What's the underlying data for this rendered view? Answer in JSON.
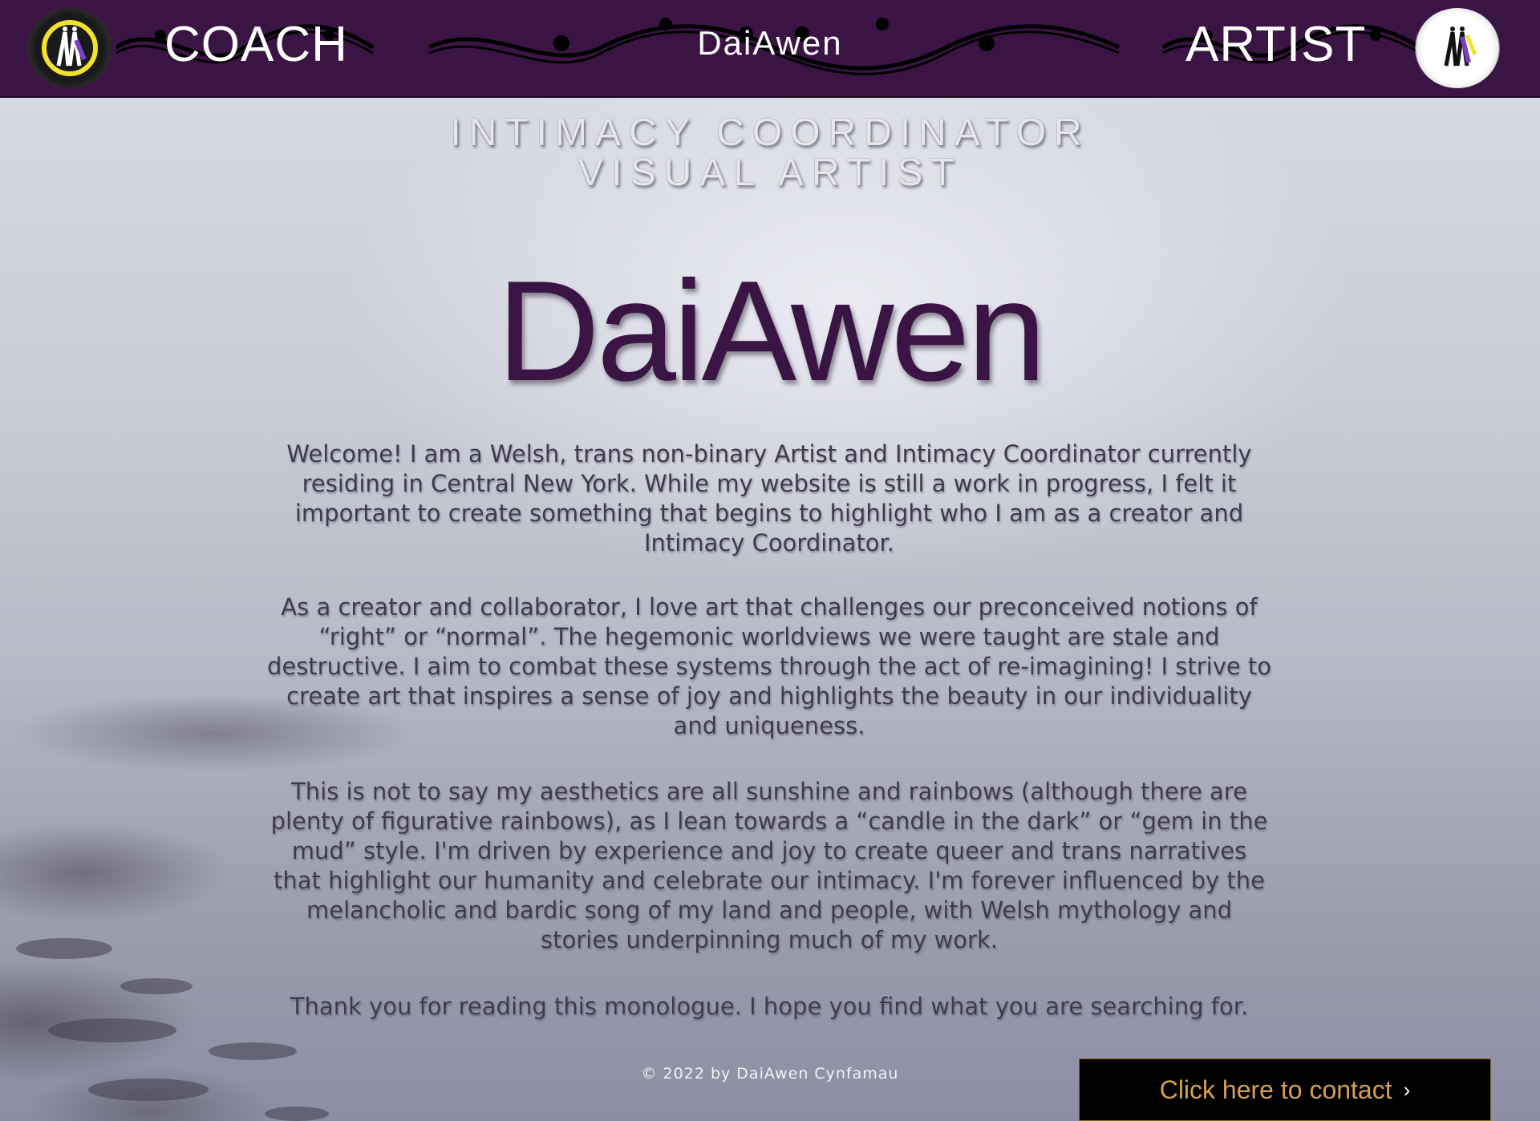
{
  "header": {
    "left_link": "COACH",
    "brand": "DaiAwen",
    "right_link": "ARTIST"
  },
  "main": {
    "subtitle_lines": [
      "INTIMACY COORDINATOR",
      "VISUAL ARTIST"
    ],
    "hero_title": "DaiAwen",
    "paragraphs": [
      "Welcome!  I am a Welsh, trans non-binary Artist and Intimacy Coordinator currently residing in Central New York. While my website is still a work in progress, I felt it important to create something that begins to highlight who I am as a creator and Intimacy Coordinator.",
      "As a creator and collaborator, I love art that challenges our preconceived notions of “right” or “normal”. The hegemonic worldviews we were taught are stale and destructive. I aim to combat these systems through the act of re-imagining! I strive to create art that inspires a sense of joy and highlights the beauty in our individuality and uniqueness.",
      "This is not to say my aesthetics are all sunshine and rainbows (although there are plenty of figurative rainbows), as I lean towards a “candle in the dark” or “gem in the mud” style. I'm driven by experience and joy to create queer and trans narratives that highlight our humanity and celebrate our intimacy. I'm forever influenced by the melancholic and bardic song of my land and people, with Welsh mythology and stories underpinning much of my work.",
      "Thank you for reading this monologue. I hope you find what you are searching for."
    ]
  },
  "footer": {
    "copyright": "© 2022 by DaiAwen Cynfamau",
    "contact_label": "Click here to contact",
    "contact_chevron": "›"
  },
  "colors": {
    "header_bg": "#3a1544",
    "hero_text": "#3a1544",
    "contact_text": "#d4a054",
    "contact_bg": "#000000"
  },
  "icons": {
    "left_logo": "daiawen-logo-dark-icon",
    "right_logo": "daiawen-logo-light-icon",
    "ornament": "vine-ornament-icon"
  }
}
